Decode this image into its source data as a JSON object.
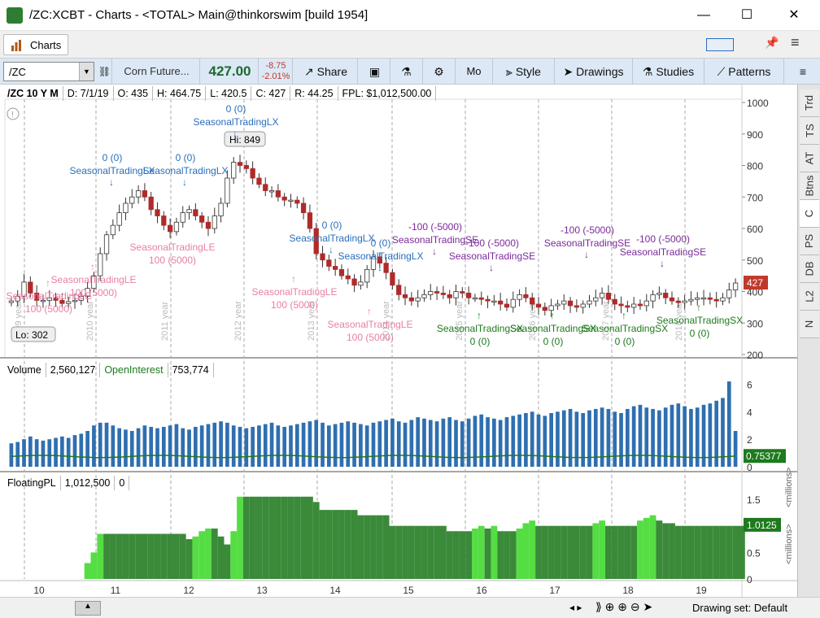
{
  "window": {
    "title": "/ZC:XCBT - Charts - <TOTAL> Main@thinkorswim [build 1954]",
    "minimize": "—",
    "maximize": "☐",
    "close": "✕"
  },
  "tabs": {
    "charts": "Charts"
  },
  "toolbar": {
    "symbol": "/ZC",
    "description": "Corn Future...",
    "last": "427.00",
    "change": "-8.75",
    "change_pct": "-2.01%",
    "share": "Share",
    "aggregation": "Mo",
    "style": "Style",
    "drawings": "Drawings",
    "studies": "Studies",
    "patterns": "Patterns"
  },
  "chart_header": {
    "title": "/ZC 10 Y M",
    "date": "D: 7/1/19",
    "open": "O: 435",
    "high": "H: 464.75",
    "low": "L: 420.5",
    "close": "C: 427",
    "range": "R: 44.25",
    "fpl": "FPL: $1,012,500.00"
  },
  "price_panel": {
    "hi_label": "Hi: 849",
    "lo_label": "Lo: 302",
    "last_badge": "427",
    "axis": [
      "1000",
      "900",
      "800",
      "700",
      "600",
      "500",
      "400",
      "300",
      "200"
    ]
  },
  "volume_panel": {
    "label": "Volume",
    "volume": "2,560,127",
    "oi_label": "OpenInterest",
    "oi": "753,774",
    "axis": [
      "6",
      "4",
      "2",
      "0"
    ],
    "last_badge": "0.75377",
    "unit": "<millions>"
  },
  "pl_panel": {
    "label": "FloatingPL",
    "value": "1,012,500",
    "extra": "0",
    "axis": [
      "1.5",
      "1",
      "0.5",
      "0"
    ],
    "last_badge": "1.0125",
    "unit": "<millions>"
  },
  "time_axis": [
    "10",
    "11",
    "12",
    "13",
    "14",
    "15",
    "16",
    "17",
    "18",
    "19"
  ],
  "year_marks": [
    "2009 year",
    "2010 year",
    "2011 year",
    "2012 year",
    "2013 year",
    "2014 year",
    "2015 year",
    "2016 year",
    "2017 year",
    "2018 year",
    "2019 year"
  ],
  "sidebar": [
    "Trd",
    "TS",
    "AT",
    "Btns",
    "C",
    "PS",
    "DB",
    "L2",
    "N"
  ],
  "status": {
    "drawing_set": "Drawing set: Default"
  },
  "colors": {
    "up": "#ffffff",
    "down": "#b02a2a",
    "vol": "#2f6fb0",
    "pl_dark": "#3a8a3a",
    "pl_light": "#55dd44",
    "le": "#e87fa3",
    "lx": "#2a6ebb",
    "se": "#7a2a9a",
    "sx": "#1d7a1d",
    "badge_red": "#c0392b",
    "badge_green": "#1d7a1d"
  },
  "signals": [
    {
      "name": "SeasonalTradingLE",
      "qty": "100 (5000)",
      "kind": "le"
    },
    {
      "name": "SeasonalTradingLX",
      "qty": "0 (0)",
      "kind": "lx"
    },
    {
      "name": "SeasonalTradingLE",
      "qty": "100 (5000)",
      "kind": "le"
    },
    {
      "name": "SeasonalTradingLX",
      "qty": "0 (0)",
      "kind": "lx"
    },
    {
      "name": "SeasonalTradingLE",
      "qty": "100 (5000)",
      "kind": "le"
    },
    {
      "name": "SeasonalTradingLX",
      "qty": "0 (0)",
      "kind": "lx"
    },
    {
      "name": "SeasonalTradingLE",
      "qty": "100 (5000)",
      "kind": "le"
    },
    {
      "name": "SeasonalTradingLX",
      "qty": "0 (0)",
      "kind": "lx"
    },
    {
      "name": "SeasonalTradingLE",
      "qty": "100 (5000)",
      "kind": "le"
    },
    {
      "name": "SeasonalTradingLX",
      "qty": "0 (0)",
      "kind": "lx"
    },
    {
      "name": "SeasonalTradingSE",
      "qty": "-100 (-5000)",
      "kind": "se"
    },
    {
      "name": "SeasonalTradingSX",
      "qty": "0 (0)",
      "kind": "sx"
    },
    {
      "name": "SeasonalTradingSE",
      "qty": "-100 (-5000)",
      "kind": "se"
    },
    {
      "name": "SeasonalTradingSX",
      "qty": "0 (0)",
      "kind": "sx"
    },
    {
      "name": "SeasonalTradingSE",
      "qty": "-100 (-5000)",
      "kind": "se"
    },
    {
      "name": "SeasonalTradingSX",
      "qty": "0 (0)",
      "kind": "sx"
    },
    {
      "name": "SeasonalTradingSE",
      "qty": "-100 (-5000)",
      "kind": "se"
    },
    {
      "name": "SeasonalTradingSX",
      "qty": "0 (0)",
      "kind": "sx"
    }
  ],
  "chart_data": {
    "type": "candlestick",
    "x_axis_labels": [
      "10",
      "11",
      "12",
      "13",
      "14",
      "15",
      "16",
      "17",
      "18",
      "19"
    ],
    "y_range": [
      200,
      1000
    ],
    "closes": [
      370,
      385,
      430,
      395,
      372,
      372,
      380,
      372,
      362,
      368,
      372,
      385,
      410,
      450,
      520,
      580,
      610,
      650,
      680,
      700,
      720,
      700,
      660,
      640,
      610,
      590,
      620,
      650,
      660,
      640,
      620,
      600,
      640,
      680,
      760,
      810,
      800,
      790,
      760,
      740,
      720,
      720,
      700,
      690,
      690,
      680,
      650,
      600,
      520,
      500,
      480,
      470,
      450,
      440,
      420,
      430,
      470,
      510,
      490,
      460,
      420,
      390,
      380,
      370,
      380,
      390,
      400,
      395,
      390,
      380,
      400,
      395,
      380,
      380,
      375,
      370,
      370,
      360,
      350,
      375,
      390,
      380,
      360,
      350,
      340,
      355,
      360,
      370,
      355,
      350,
      360,
      370,
      380,
      395,
      375,
      360,
      355,
      350,
      360,
      355,
      370,
      390,
      395,
      380,
      370,
      365,
      370,
      375,
      380,
      380,
      375,
      370,
      380,
      405,
      427
    ],
    "volume_millions": [
      1.7,
      1.8,
      2.0,
      2.2,
      2.0,
      1.9,
      2.0,
      2.1,
      2.2,
      2.1,
      2.3,
      2.4,
      2.6,
      3.0,
      3.2,
      3.2,
      3.0,
      2.8,
      2.7,
      2.6,
      2.8,
      3.0,
      2.9,
      2.8,
      2.9,
      3.0,
      3.1,
      2.8,
      2.7,
      2.9,
      3.0,
      3.1,
      3.2,
      3.3,
      3.2,
      3.0,
      2.9,
      2.8,
      2.9,
      3.0,
      3.1,
      3.2,
      3.0,
      2.9,
      3.0,
      3.1,
      3.2,
      3.3,
      3.4,
      3.2,
      3.0,
      3.1,
      3.2,
      3.3,
      3.2,
      3.1,
      3.0,
      3.2,
      3.3,
      3.4,
      3.5,
      3.3,
      3.2,
      3.4,
      3.6,
      3.5,
      3.4,
      3.3,
      3.5,
      3.6,
      3.4,
      3.3,
      3.5,
      3.7,
      3.8,
      3.6,
      3.5,
      3.4,
      3.6,
      3.7,
      3.8,
      3.9,
      4.0,
      3.8,
      3.7,
      3.9,
      4.0,
      4.1,
      4.2,
      4.0,
      3.9,
      4.1,
      4.2,
      4.3,
      4.2,
      4.0,
      3.9,
      4.2,
      4.4,
      4.5,
      4.3,
      4.2,
      4.1,
      4.3,
      4.5,
      4.6,
      4.4,
      4.2,
      4.3,
      4.5,
      4.6,
      4.8,
      5.0,
      6.2,
      2.6
    ],
    "floating_pl_millions": [
      0,
      0,
      0,
      0,
      0,
      0,
      0,
      0,
      0,
      0,
      0,
      0,
      0.3,
      0.5,
      0.85,
      0.85,
      0.85,
      0.85,
      0.85,
      0.85,
      0.85,
      0.85,
      0.85,
      0.85,
      0.85,
      0.85,
      0.85,
      0.85,
      0.75,
      0.8,
      0.9,
      0.95,
      0.95,
      0.8,
      0.65,
      0.9,
      1.55,
      1.55,
      1.55,
      1.55,
      1.55,
      1.55,
      1.55,
      1.55,
      1.55,
      1.55,
      1.55,
      1.55,
      1.45,
      1.3,
      1.3,
      1.3,
      1.3,
      1.3,
      1.3,
      1.2,
      1.2,
      1.2,
      1.2,
      1.2,
      1.0,
      1.0,
      1.0,
      1.0,
      1.0,
      1.0,
      1.0,
      1.0,
      1.0,
      0.9,
      0.9,
      0.9,
      0.9,
      0.95,
      1.0,
      0.95,
      1.0,
      0.9,
      0.9,
      0.9,
      0.95,
      1.05,
      1.1,
      1.0,
      1.0,
      1.0,
      1.0,
      1.0,
      1.0,
      1.0,
      1.0,
      1.0,
      1.05,
      1.1,
      1.0,
      1.0,
      1.0,
      1.0,
      1.0,
      1.1,
      1.15,
      1.2,
      1.1,
      1.05,
      1.05,
      1.0,
      1.0,
      1.0,
      1.0,
      1.0,
      1.0,
      1.0,
      1.0,
      1.0,
      1.0,
      1.0
    ]
  }
}
